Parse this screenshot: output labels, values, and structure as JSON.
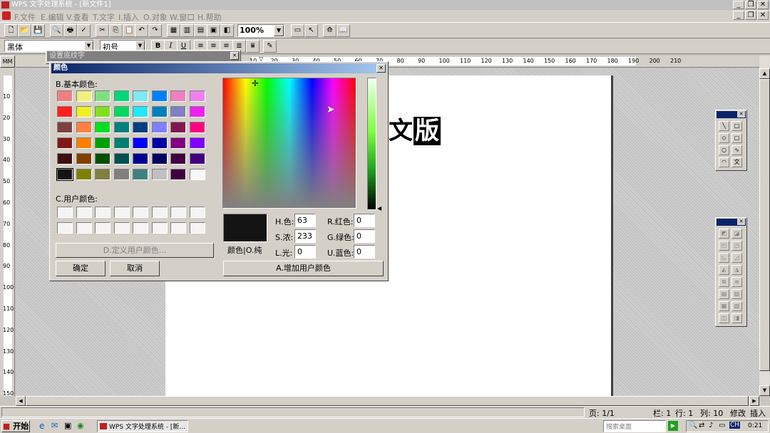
{
  "app": {
    "title": "WPS 文字处理系统 - [新文件1]",
    "menu": [
      "F.文件",
      "E.编辑",
      "V.查看",
      "T.文字",
      "I.插入",
      "O.对象",
      "W.窗口",
      "H.帮助"
    ]
  },
  "toolbar": {
    "zoom": "100%"
  },
  "format_bar": {
    "font": "黑体",
    "size": "初号",
    "bold": "B",
    "italic": "I",
    "underline": "U"
  },
  "ruler": {
    "unit": "MM",
    "h_ticks": [
      "10",
      "20",
      "30",
      "40",
      "50",
      "60",
      "70",
      "80",
      "90",
      "100",
      "110",
      "120",
      "130",
      "140",
      "150",
      "160",
      "170",
      "180",
      "190",
      "200",
      "210"
    ],
    "v_ticks": [
      "10",
      "20",
      "30",
      "40",
      "50",
      "60",
      "70",
      "80",
      "90",
      "100",
      "110",
      "120",
      "130",
      "140",
      "150"
    ]
  },
  "document": {
    "text_chars": [
      "文",
      "版"
    ]
  },
  "back_dialog": {
    "title": "设置底纹字"
  },
  "color_dialog": {
    "title": "颜色",
    "basic_label": "B.基本颜色:",
    "custom_label": "C.用户颜色:",
    "define_button": "D.定义用户颜色...",
    "ok_button": "确定",
    "cancel_button": "取消",
    "preview_label": "颜色|O.纯",
    "add_button": "A.增加用户颜色",
    "h_label": "H.色:",
    "h_value": "63",
    "s_label": "S.浓:",
    "s_value": "233",
    "l_label": "L.光:",
    "l_value": "0",
    "r_label": "R.红色:",
    "r_value": "0",
    "g_label": "G.绿色:",
    "g_value": "0",
    "b_label": "U.蓝色:",
    "b_value": "0",
    "basic_colors": [
      [
        "#f08080",
        "#f0f080",
        "#80e080",
        "#00d878",
        "#80e8f0",
        "#0080ff",
        "#f080c0",
        "#f080f0"
      ],
      [
        "#ff2020",
        "#f0f020",
        "#80e020",
        "#00d860",
        "#20e8f8",
        "#0080c0",
        "#8080c0",
        "#f020f0"
      ],
      [
        "#804040",
        "#ff8040",
        "#00e020",
        "#008080",
        "#004080",
        "#8080ff",
        "#801850",
        "#ff0080"
      ],
      [
        "#801818",
        "#ff8000",
        "#00a000",
        "#008070",
        "#0000ff",
        "#0000a0",
        "#800080",
        "#8000ff"
      ],
      [
        "#401010",
        "#804000",
        "#005000",
        "#005050",
        "#000090",
        "#000060",
        "#400040",
        "#400080"
      ],
      [
        "#141414",
        "#808000",
        "#808040",
        "#808080",
        "#408080",
        "#c0c0c0",
        "#400040",
        "#f8f8f8"
      ]
    ]
  },
  "status_bar": {
    "page": "页: 1/1",
    "column_label": "栏: 1",
    "row": "行: 1",
    "col": "列: 10",
    "mode1": "修改",
    "mode2": "插入"
  },
  "taskbar": {
    "start": "开始",
    "task": "WPS 文字处理系统 - [新...",
    "search": "搜索桌面",
    "ime": "CH",
    "time": "0:21"
  }
}
